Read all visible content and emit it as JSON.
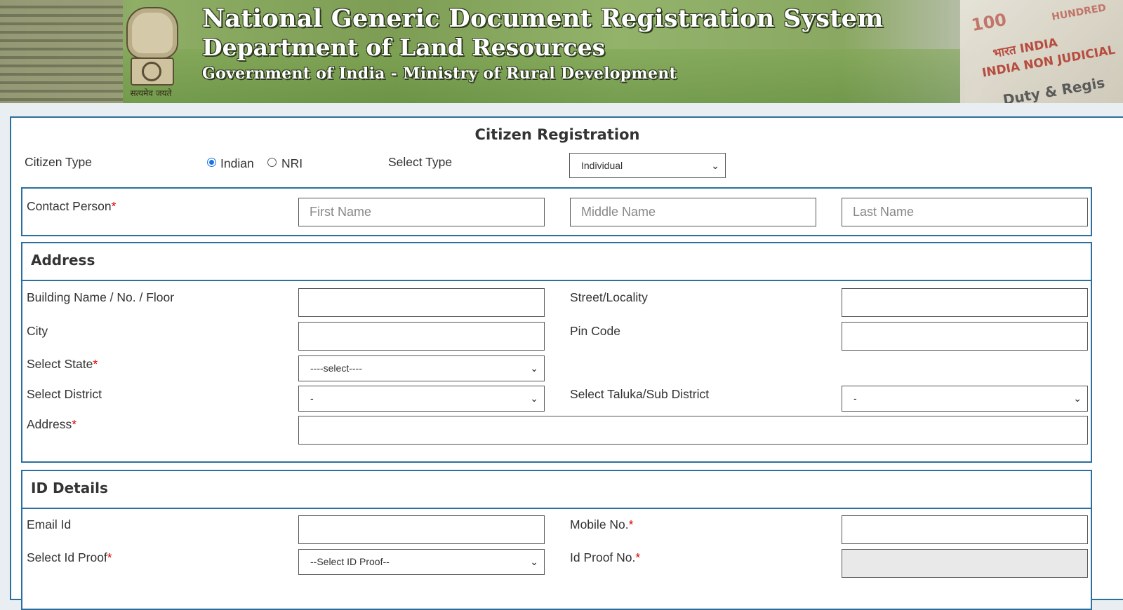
{
  "banner": {
    "title": "National Generic Document Registration System",
    "department": "Department of Land Resources",
    "ministry": "Government of India - Ministry of Rural Development",
    "emblem_motto": "सत्यमेव जयते",
    "stamp_text": {
      "value": "100",
      "hundred": "HUNDRED",
      "india": "भारत INDIA",
      "non_judicial": "INDIA NON JUDICIAL",
      "duty": "Duty & Regis"
    }
  },
  "form": {
    "title": "Citizen Registration",
    "citizen_type_label": "Citizen Type",
    "citizen_options": [
      "Indian",
      "NRI"
    ],
    "citizen_selected": "Indian",
    "select_type_label": "Select Type",
    "select_type_value": "Individual",
    "contact": {
      "label": "Contact Person",
      "required": "*",
      "first_placeholder": "First Name",
      "middle_placeholder": "Middle Name",
      "last_placeholder": "Last Name"
    },
    "address": {
      "heading": "Address",
      "building_label": "Building Name / No. / Floor",
      "street_label": "Street/Locality",
      "city_label": "City",
      "pin_label": "Pin Code",
      "state_label": "Select State",
      "state_value": "----select----",
      "district_label": "Select District",
      "district_value": "-",
      "taluka_label": "Select Taluka/Sub District",
      "taluka_value": "-",
      "address_label": "Address",
      "required": "*"
    },
    "id_details": {
      "heading": "ID Details",
      "email_label": "Email Id",
      "mobile_label": "Mobile No.",
      "id_proof_label": "Select Id Proof",
      "id_proof_value": "--Select ID Proof--",
      "id_proof_no_label": "Id Proof No.",
      "required": "*"
    }
  },
  "colors": {
    "accent_border": "#2b6f9e",
    "required": "#dd0000",
    "radio_selected": "#1a73e8"
  }
}
